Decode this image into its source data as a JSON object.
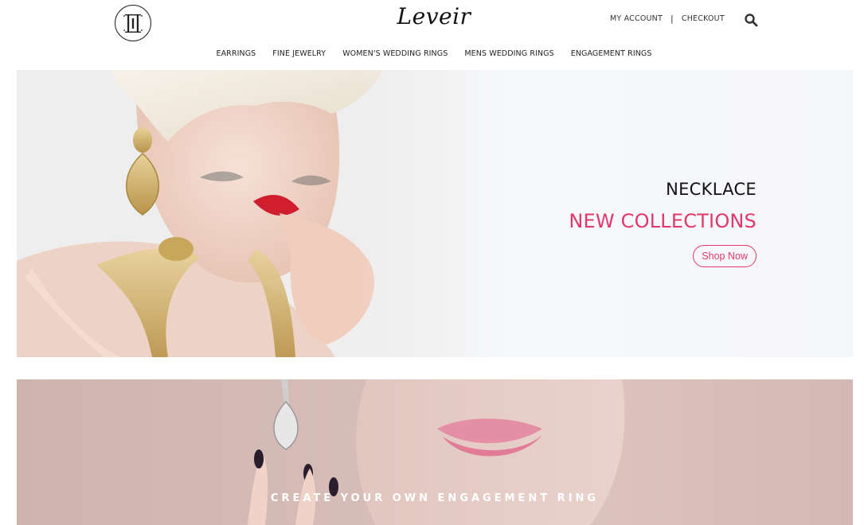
{
  "header": {
    "brand": "Leveir",
    "account_label": "MY ACCOUNT",
    "separator": "|",
    "checkout_label": "CHECKOUT"
  },
  "nav": {
    "items": [
      "EARRINGS",
      "FINE JEWELRY",
      "WOMEN'S WEDDING RINGS",
      "MENS WEDDING RINGS",
      "ENGAGEMENT RINGS"
    ]
  },
  "hero": {
    "subtitle": "NECKLACE",
    "title": "NEW COLLECTIONS",
    "button_label": "Shop Now"
  },
  "promo": {
    "title": "CREATE YOUR OWN ENGAGEMENT RING"
  },
  "colors": {
    "accent": "#e0386a",
    "text": "#222222",
    "background": "#ffffff"
  },
  "icons": {
    "logo": "monogram-emblem-icon",
    "search": "search-icon"
  }
}
